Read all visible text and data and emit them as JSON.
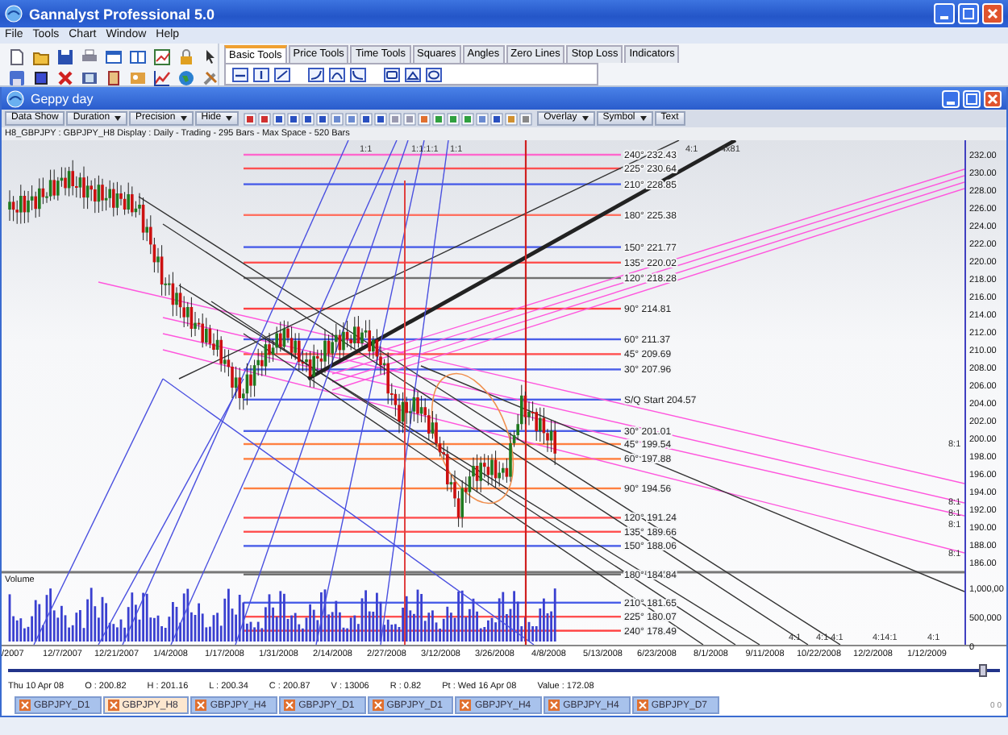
{
  "window": {
    "title": "Gannalyst Professional 5.0"
  },
  "menu": [
    "File",
    "Tools",
    "Chart",
    "Window",
    "Help"
  ],
  "tool_tabs": [
    {
      "label": "Basic Tools",
      "selected": true
    },
    {
      "label": "Price Tools",
      "selected": false
    },
    {
      "label": "Time Tools",
      "selected": false
    },
    {
      "label": "Squares",
      "selected": false
    },
    {
      "label": "Angles",
      "selected": false
    },
    {
      "label": "Zero Lines",
      "selected": false
    },
    {
      "label": "Stop Loss",
      "selected": false
    },
    {
      "label": "Indicators",
      "selected": false
    }
  ],
  "chart_window": {
    "title": "Geppy day",
    "toolbar": [
      {
        "kind": "button",
        "label": "Data Show"
      },
      {
        "kind": "dropdown",
        "label": "Duration"
      },
      {
        "kind": "dropdown",
        "label": "Precision"
      },
      {
        "kind": "dropdown",
        "label": "Hide"
      },
      {
        "kind": "icon_strip"
      },
      {
        "kind": "dropdown",
        "label": "Overlay"
      },
      {
        "kind": "dropdown",
        "label": "Symbol"
      },
      {
        "kind": "button",
        "label": "Text"
      }
    ],
    "info": "H8_GBPJPY : GBPJPY_H8 Display :  Daily  - Trading - 295 Bars -  Max Space - 520 Bars",
    "levels": [
      {
        "label": "240° 232.43",
        "color": "#ff66cc"
      },
      {
        "label": "225° 230.64",
        "color": "#ff5050"
      },
      {
        "label": "210° 228.85",
        "color": "#4a5ee8"
      },
      {
        "label": "180° 225.38",
        "color": "#ff7060"
      },
      {
        "label": "150° 221.77",
        "color": "#4a5ee8"
      },
      {
        "label": "135° 220.02",
        "color": "#ff5050"
      },
      {
        "label": "120° 218.28",
        "color": "#707070"
      },
      {
        "label": "90° 214.81",
        "color": "#ff4040"
      },
      {
        "label": "60° 211.37",
        "color": "#4a5ee8"
      },
      {
        "label": "45° 209.69",
        "color": "#ff5050"
      },
      {
        "label": "30° 207.96",
        "color": "#4a5ee8"
      },
      {
        "label": "S/Q Start 204.57",
        "color": "#4a5ee8"
      },
      {
        "label": "30° 201.01",
        "color": "#4a5ee8"
      },
      {
        "label": "45° 199.54",
        "color": "#ff8040"
      },
      {
        "label": "60° 197.88",
        "color": "#ff8040"
      },
      {
        "label": "90° 194.56",
        "color": "#ff8040"
      },
      {
        "label": "120° 191.24",
        "color": "#ff5050"
      },
      {
        "label": "135° 189.66",
        "color": "#ff5050"
      },
      {
        "label": "150° 188.06",
        "color": "#4a5ee8"
      },
      {
        "label": "180° 184.84",
        "color": "#707070"
      },
      {
        "label": "210° 181.65",
        "color": "#4a5ee8"
      },
      {
        "label": "225° 180.07",
        "color": "#ff5050"
      },
      {
        "label": "240° 178.49",
        "color": "#ff4040"
      }
    ],
    "ray_labels": [
      "1:1",
      "1:1:1:1",
      "1:1",
      "4:1",
      "4x81",
      "8:1",
      "8:1",
      "8:1",
      "8:1",
      "8:1",
      "4:1",
      "4:1 4:1",
      "4:14:1",
      "4:1"
    ],
    "price_axis": [
      "232.00",
      "230.00",
      "228.00",
      "226.00",
      "224.00",
      "222.00",
      "220.00",
      "218.00",
      "216.00",
      "214.00",
      "212.00",
      "210.00",
      "208.00",
      "206.00",
      "204.00",
      "202.00",
      "200.00",
      "198.00",
      "196.00",
      "194.00",
      "192.00",
      "190.00",
      "188.00",
      "186.00"
    ],
    "volume_panel": {
      "label": "Volume",
      "axis": [
        "1,000,00",
        "500,000",
        "0"
      ]
    },
    "date_axis": [
      "/2007",
      "12/7/2007",
      "12/21/2007",
      "1/4/2008",
      "1/17/2008",
      "1/31/2008",
      "2/14/2008",
      "2/27/2008",
      "3/12/2008",
      "3/26/2008",
      "4/8/2008",
      "5/13/2008",
      "6/23/2008",
      "8/1/2008",
      "9/11/2008",
      "10/22/2008",
      "12/2/2008",
      "1/12/2009"
    ],
    "status": [
      "Thu 10 Apr 08",
      "O : 200.82",
      "H : 201.16",
      "L : 200.34",
      "C : 200.87",
      "V : 13006",
      "R : 0.82",
      "Pt : Wed 16 Apr 08",
      "Value : 172.08"
    ],
    "symbol_tabs": [
      {
        "label": "GBPJPY_D1",
        "selected": false
      },
      {
        "label": "GBPJPY_H8",
        "selected": true
      },
      {
        "label": "GBPJPY_H4",
        "selected": false
      },
      {
        "label": "GBPJPY_D1",
        "selected": false
      },
      {
        "label": "GBPJPY_D1",
        "selected": false
      },
      {
        "label": "GBPJPY_H4",
        "selected": false
      },
      {
        "label": "GBPJPY_H4",
        "selected": false
      },
      {
        "label": "GBPJPY_D7",
        "selected": false
      }
    ],
    "corner": "0 0"
  }
}
